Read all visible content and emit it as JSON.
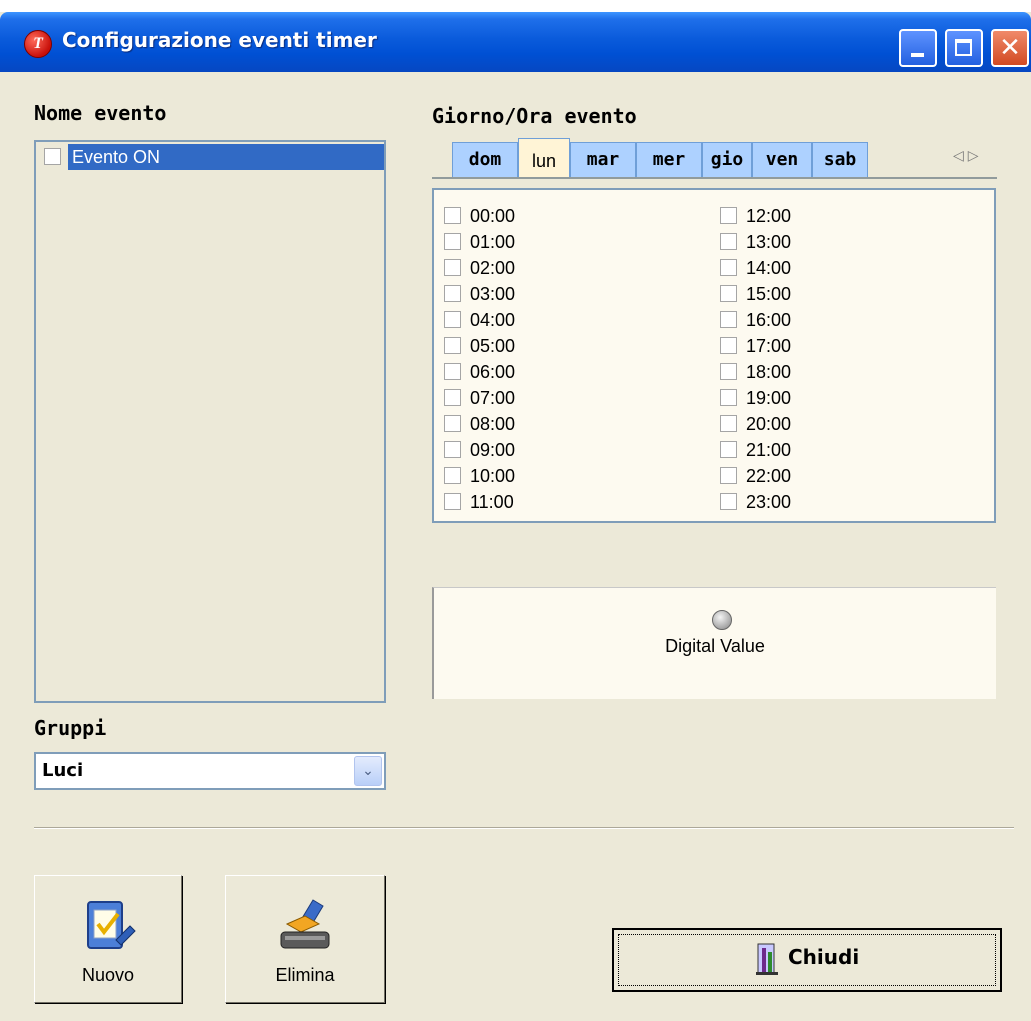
{
  "window": {
    "title": "Configurazione eventi timer"
  },
  "events": {
    "label": "Nome evento",
    "items": [
      {
        "label": "Evento ON",
        "checked": false,
        "selected": true
      }
    ]
  },
  "schedule": {
    "label": "Giorno/Ora evento",
    "days": [
      "dom",
      "lun",
      "mar",
      "mer",
      "gio",
      "ven",
      "sab"
    ],
    "active_day": "lun",
    "hours_left": [
      "00:00",
      "01:00",
      "02:00",
      "03:00",
      "04:00",
      "05:00",
      "06:00",
      "07:00",
      "08:00",
      "09:00",
      "10:00",
      "11:00"
    ],
    "hours_right": [
      "12:00",
      "13:00",
      "14:00",
      "15:00",
      "16:00",
      "17:00",
      "18:00",
      "19:00",
      "20:00",
      "21:00",
      "22:00",
      "23:00"
    ]
  },
  "digital_value": {
    "label": "Digital Value"
  },
  "groups": {
    "label": "Gruppi",
    "selected": "Luci"
  },
  "buttons": {
    "new_label": "Nuovo",
    "delete_label": "Elimina",
    "close_label": "Chiudi"
  }
}
